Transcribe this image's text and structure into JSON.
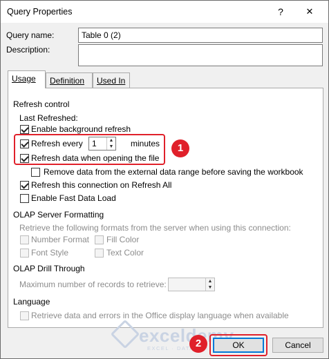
{
  "window": {
    "title": "Query Properties",
    "help_glyph": "?",
    "close_glyph": "✕"
  },
  "query_name": {
    "label": "Query name:",
    "value": "Table 0 (2)"
  },
  "description": {
    "label": "Description:",
    "value": ""
  },
  "tabs": [
    {
      "label": "Usage"
    },
    {
      "label": "Definition"
    },
    {
      "label": "Used In"
    }
  ],
  "refresh_control": {
    "heading": "Refresh control",
    "last_refreshed": "Last Refreshed:",
    "enable_background": "Enable background refresh",
    "refresh_every_label": "Refresh every",
    "refresh_every_value": "1",
    "minutes_label": "minutes",
    "refresh_on_open": "Refresh data when opening the file",
    "remove_data": "Remove data from the external data range before saving the workbook",
    "refresh_on_refresh_all": "Refresh this connection on Refresh All",
    "enable_fast_load": "Enable Fast Data Load"
  },
  "olap_formatting": {
    "heading": "OLAP Server Formatting",
    "description": "Retrieve the following formats from the server when using this connection:",
    "number_format": "Number Format",
    "fill_color": "Fill Color",
    "font_style": "Font Style",
    "text_color": "Text Color"
  },
  "olap_drill": {
    "heading": "OLAP Drill Through",
    "max_records_label": "Maximum number of records to retrieve:",
    "max_records_value": ""
  },
  "language": {
    "heading": "Language",
    "retrieve_label": "Retrieve data and errors in the Office display language when available"
  },
  "buttons": {
    "ok": "OK",
    "cancel": "Cancel"
  },
  "annotations": {
    "badge1": "1",
    "badge2": "2",
    "color": "#e0202a"
  },
  "watermark": {
    "name": "exceldemy",
    "tagline": "EXCEL · DATA · BI"
  }
}
